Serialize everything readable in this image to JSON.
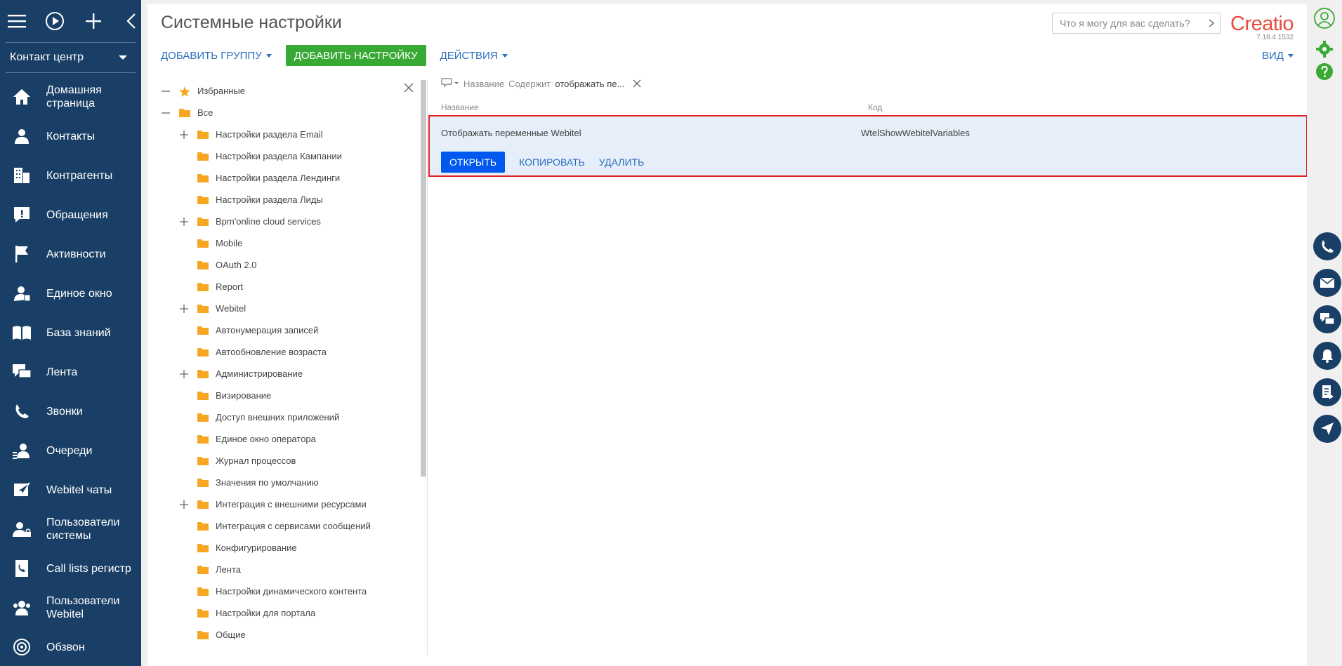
{
  "leftnav": {
    "workspace": "Контакт центр",
    "items": [
      {
        "label": "Домашняя\nстраница",
        "icon": "home-icon"
      },
      {
        "label": "Контакты",
        "icon": "contact-icon"
      },
      {
        "label": "Контрагенты",
        "icon": "building-icon"
      },
      {
        "label": "Обращения",
        "icon": "case-icon"
      },
      {
        "label": "Активности",
        "icon": "flag-icon"
      },
      {
        "label": "Единое окно",
        "icon": "agent-icon"
      },
      {
        "label": "База знаний",
        "icon": "book-icon"
      },
      {
        "label": "Лента",
        "icon": "feed-icon"
      },
      {
        "label": "Звонки",
        "icon": "phone-icon"
      },
      {
        "label": "Очереди",
        "icon": "queue-icon"
      },
      {
        "label": "Webitel чаты",
        "icon": "chat-icon"
      },
      {
        "label": "Пользователи\nсистемы",
        "icon": "users-lock-icon"
      },
      {
        "label": "Call lists регистр",
        "icon": "call-list-icon"
      },
      {
        "label": "Пользователи\nWebitel",
        "icon": "users-icon"
      },
      {
        "label": "Обзвон",
        "icon": "dialer-icon"
      }
    ]
  },
  "header": {
    "title": "Системные настройки",
    "assistant_placeholder": "Что я могу для вас сделать?",
    "logo": "Creatio",
    "version": "7.18.4.1532"
  },
  "toolbar": {
    "add_group": "Добавить группу",
    "add_setting": "ДОБАВИТЬ НАСТРОЙКУ",
    "actions": "Действия",
    "view": "Вид"
  },
  "tree": {
    "nodes": [
      {
        "label": "Избранные",
        "level": 0,
        "toggle": "−",
        "icon": "star-icon"
      },
      {
        "label": "Все",
        "level": 0,
        "toggle": "−",
        "icon": "folder-icon"
      },
      {
        "label": "Настройки раздела Email",
        "level": 1,
        "toggle": "+",
        "icon": "folder-icon"
      },
      {
        "label": "Настройки раздела Кампании",
        "level": 1,
        "toggle": "",
        "icon": "folder-icon"
      },
      {
        "label": "Настройки раздела Лендинги",
        "level": 1,
        "toggle": "",
        "icon": "folder-icon"
      },
      {
        "label": "Настройки раздела Лиды",
        "level": 1,
        "toggle": "",
        "icon": "folder-icon"
      },
      {
        "label": "Bpm'online cloud services",
        "level": 1,
        "toggle": "+",
        "icon": "folder-icon"
      },
      {
        "label": "Mobile",
        "level": 1,
        "toggle": "",
        "icon": "folder-icon"
      },
      {
        "label": "OAuth 2.0",
        "level": 1,
        "toggle": "",
        "icon": "folder-icon"
      },
      {
        "label": "Report",
        "level": 1,
        "toggle": "",
        "icon": "folder-icon"
      },
      {
        "label": "Webitel",
        "level": 1,
        "toggle": "+",
        "icon": "folder-icon"
      },
      {
        "label": "Автонумерация записей",
        "level": 1,
        "toggle": "",
        "icon": "folder-icon"
      },
      {
        "label": "Автообновление возраста",
        "level": 1,
        "toggle": "",
        "icon": "folder-icon"
      },
      {
        "label": "Администрирование",
        "level": 1,
        "toggle": "+",
        "icon": "folder-icon"
      },
      {
        "label": "Визирование",
        "level": 1,
        "toggle": "",
        "icon": "folder-icon"
      },
      {
        "label": "Доступ внешних приложений",
        "level": 1,
        "toggle": "",
        "icon": "folder-icon"
      },
      {
        "label": "Единое окно оператора",
        "level": 1,
        "toggle": "",
        "icon": "folder-icon"
      },
      {
        "label": "Журнал процессов",
        "level": 1,
        "toggle": "",
        "icon": "folder-icon"
      },
      {
        "label": "Значения по умолчанию",
        "level": 1,
        "toggle": "",
        "icon": "folder-icon"
      },
      {
        "label": "Интеграция с внешними ресурсами",
        "level": 1,
        "toggle": "+",
        "icon": "folder-icon"
      },
      {
        "label": "Интеграция с сервисами сообщений",
        "level": 1,
        "toggle": "",
        "icon": "folder-icon"
      },
      {
        "label": "Конфигурирование",
        "level": 1,
        "toggle": "",
        "icon": "folder-icon"
      },
      {
        "label": "Лента",
        "level": 1,
        "toggle": "",
        "icon": "folder-icon"
      },
      {
        "label": "Настройки динамического контента",
        "level": 1,
        "toggle": "",
        "icon": "folder-icon"
      },
      {
        "label": "Настройки для портала",
        "level": 1,
        "toggle": "",
        "icon": "folder-icon"
      },
      {
        "label": "Общие",
        "level": 1,
        "toggle": "",
        "icon": "folder-icon"
      }
    ]
  },
  "filter": {
    "column": "Название",
    "operator": "Содержит",
    "value": "отображать пе..."
  },
  "grid": {
    "columns": [
      "Название",
      "Код"
    ],
    "rows": [
      {
        "name": "Отображать переменные Webitel",
        "code": "WtelShowWebitelVariables"
      }
    ],
    "row_actions": {
      "open": "ОТКРЫТЬ",
      "copy": "КОПИРОВАТЬ",
      "delete": "УДАЛИТЬ"
    }
  },
  "colors": {
    "nav_bg": "#1a3f66",
    "accent_green": "#39a935",
    "open_blue": "#0058ef",
    "highlight_red": "#e32525",
    "folder": "#f6a623"
  },
  "rail": {
    "buttons": [
      "phone-icon",
      "mail-icon",
      "chat-icon",
      "bell-icon",
      "script-icon",
      "send-icon"
    ]
  }
}
